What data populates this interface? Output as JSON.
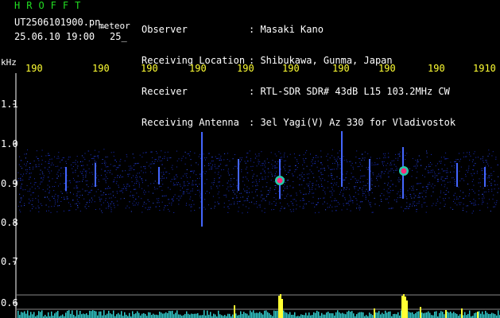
{
  "header": {
    "app_title": "HROFFT",
    "file_name": "UT2506101900.pn_",
    "mode": "meteor",
    "date_time": "25.06.10 19:00",
    "minute": "25_"
  },
  "info": {
    "labels": [
      "Observer",
      "Receiving Location",
      "Receiver",
      "Receiving Antenna"
    ],
    "values": [
      ": Masaki Kano",
      ": Shibukawa, Gunma, Japan",
      ": RTL-SDR SDR# 43dB L15 103.2MHz CW",
      ": 3el Yagi(V) Az 330 for Vladivostok"
    ]
  },
  "axis": {
    "unit": "kHz",
    "time_ticks": [
      "190",
      "190",
      "190",
      "190",
      "190",
      "190",
      "190",
      "190",
      "190",
      "1910"
    ],
    "freq_ticks": [
      "1.1",
      "1.0",
      "0.9",
      "0.8",
      "0.7",
      "0.6"
    ]
  },
  "colors": {
    "background": "#000000",
    "text": "#ffffff",
    "title": "#22dd22",
    "ticks": "#ffff33",
    "noise_band": "#1a2fc0",
    "echo_core": "#ff2a7a",
    "histogram": "#33cccc"
  }
}
